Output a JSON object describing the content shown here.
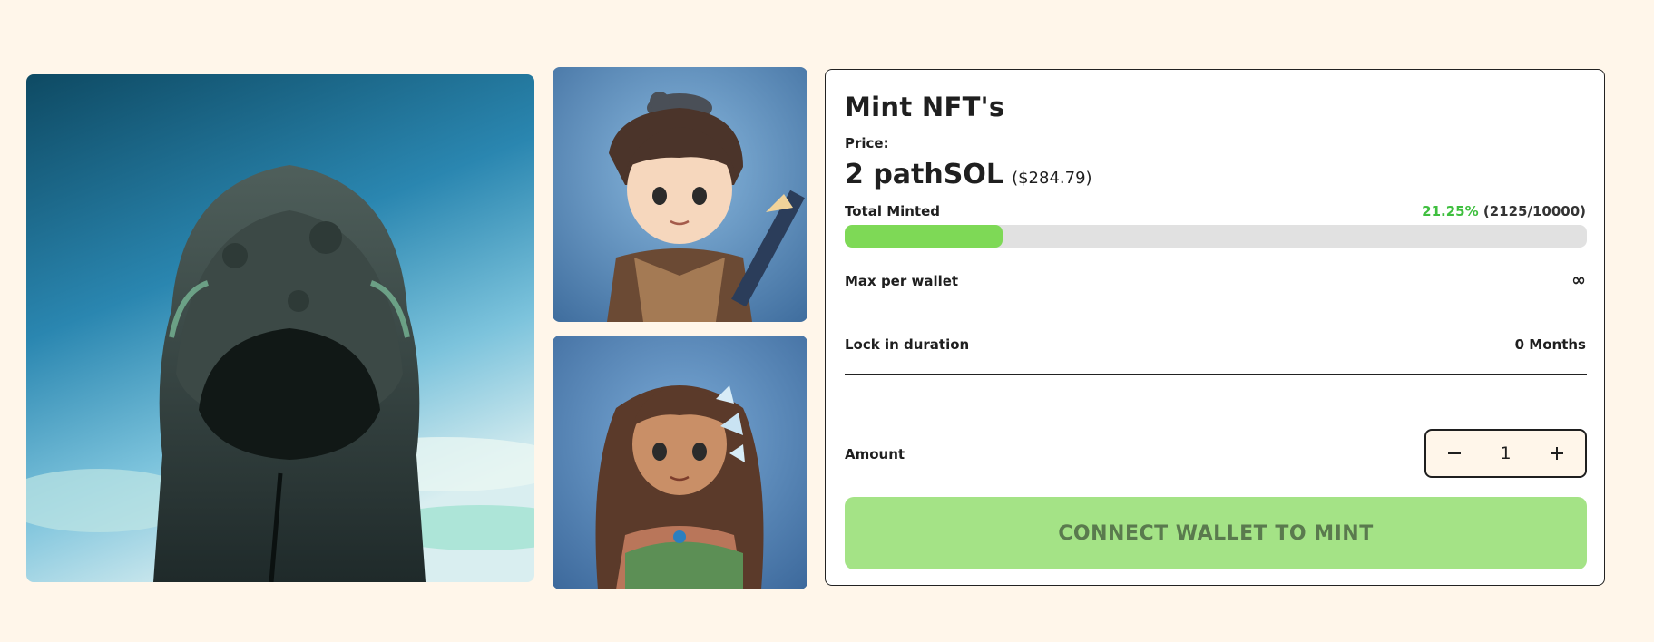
{
  "images": {
    "main": "hooded-figure-nft",
    "top": "boy-with-cat-nft",
    "bottom": "girl-with-butterflies-nft"
  },
  "mint": {
    "title": "Mint NFT's",
    "price_label": "Price:",
    "price_value": "2 pathSOL",
    "price_usd": "($284.79)",
    "total_minted_label": "Total Minted",
    "minted_percent_text": "21.25%",
    "minted_count_text": "(2125/10000)",
    "minted_fraction": 0.2125,
    "max_per_wallet_label": "Max per wallet",
    "max_per_wallet_value": "∞",
    "lock_label": "Lock in duration",
    "lock_value": "0 Months",
    "amount_label": "Amount",
    "amount_value": "1",
    "cta_label": "CONNECT WALLET TO MINT"
  },
  "colors": {
    "background": "#fff6ea",
    "progress_fill": "#7ed956",
    "progress_track": "#e1e1e1",
    "percent_text": "#3fbf3f",
    "cta_bg": "#a4e386",
    "cta_text": "#5a7a4e"
  },
  "icons": {
    "minus": "minus-icon",
    "plus": "plus-icon"
  }
}
